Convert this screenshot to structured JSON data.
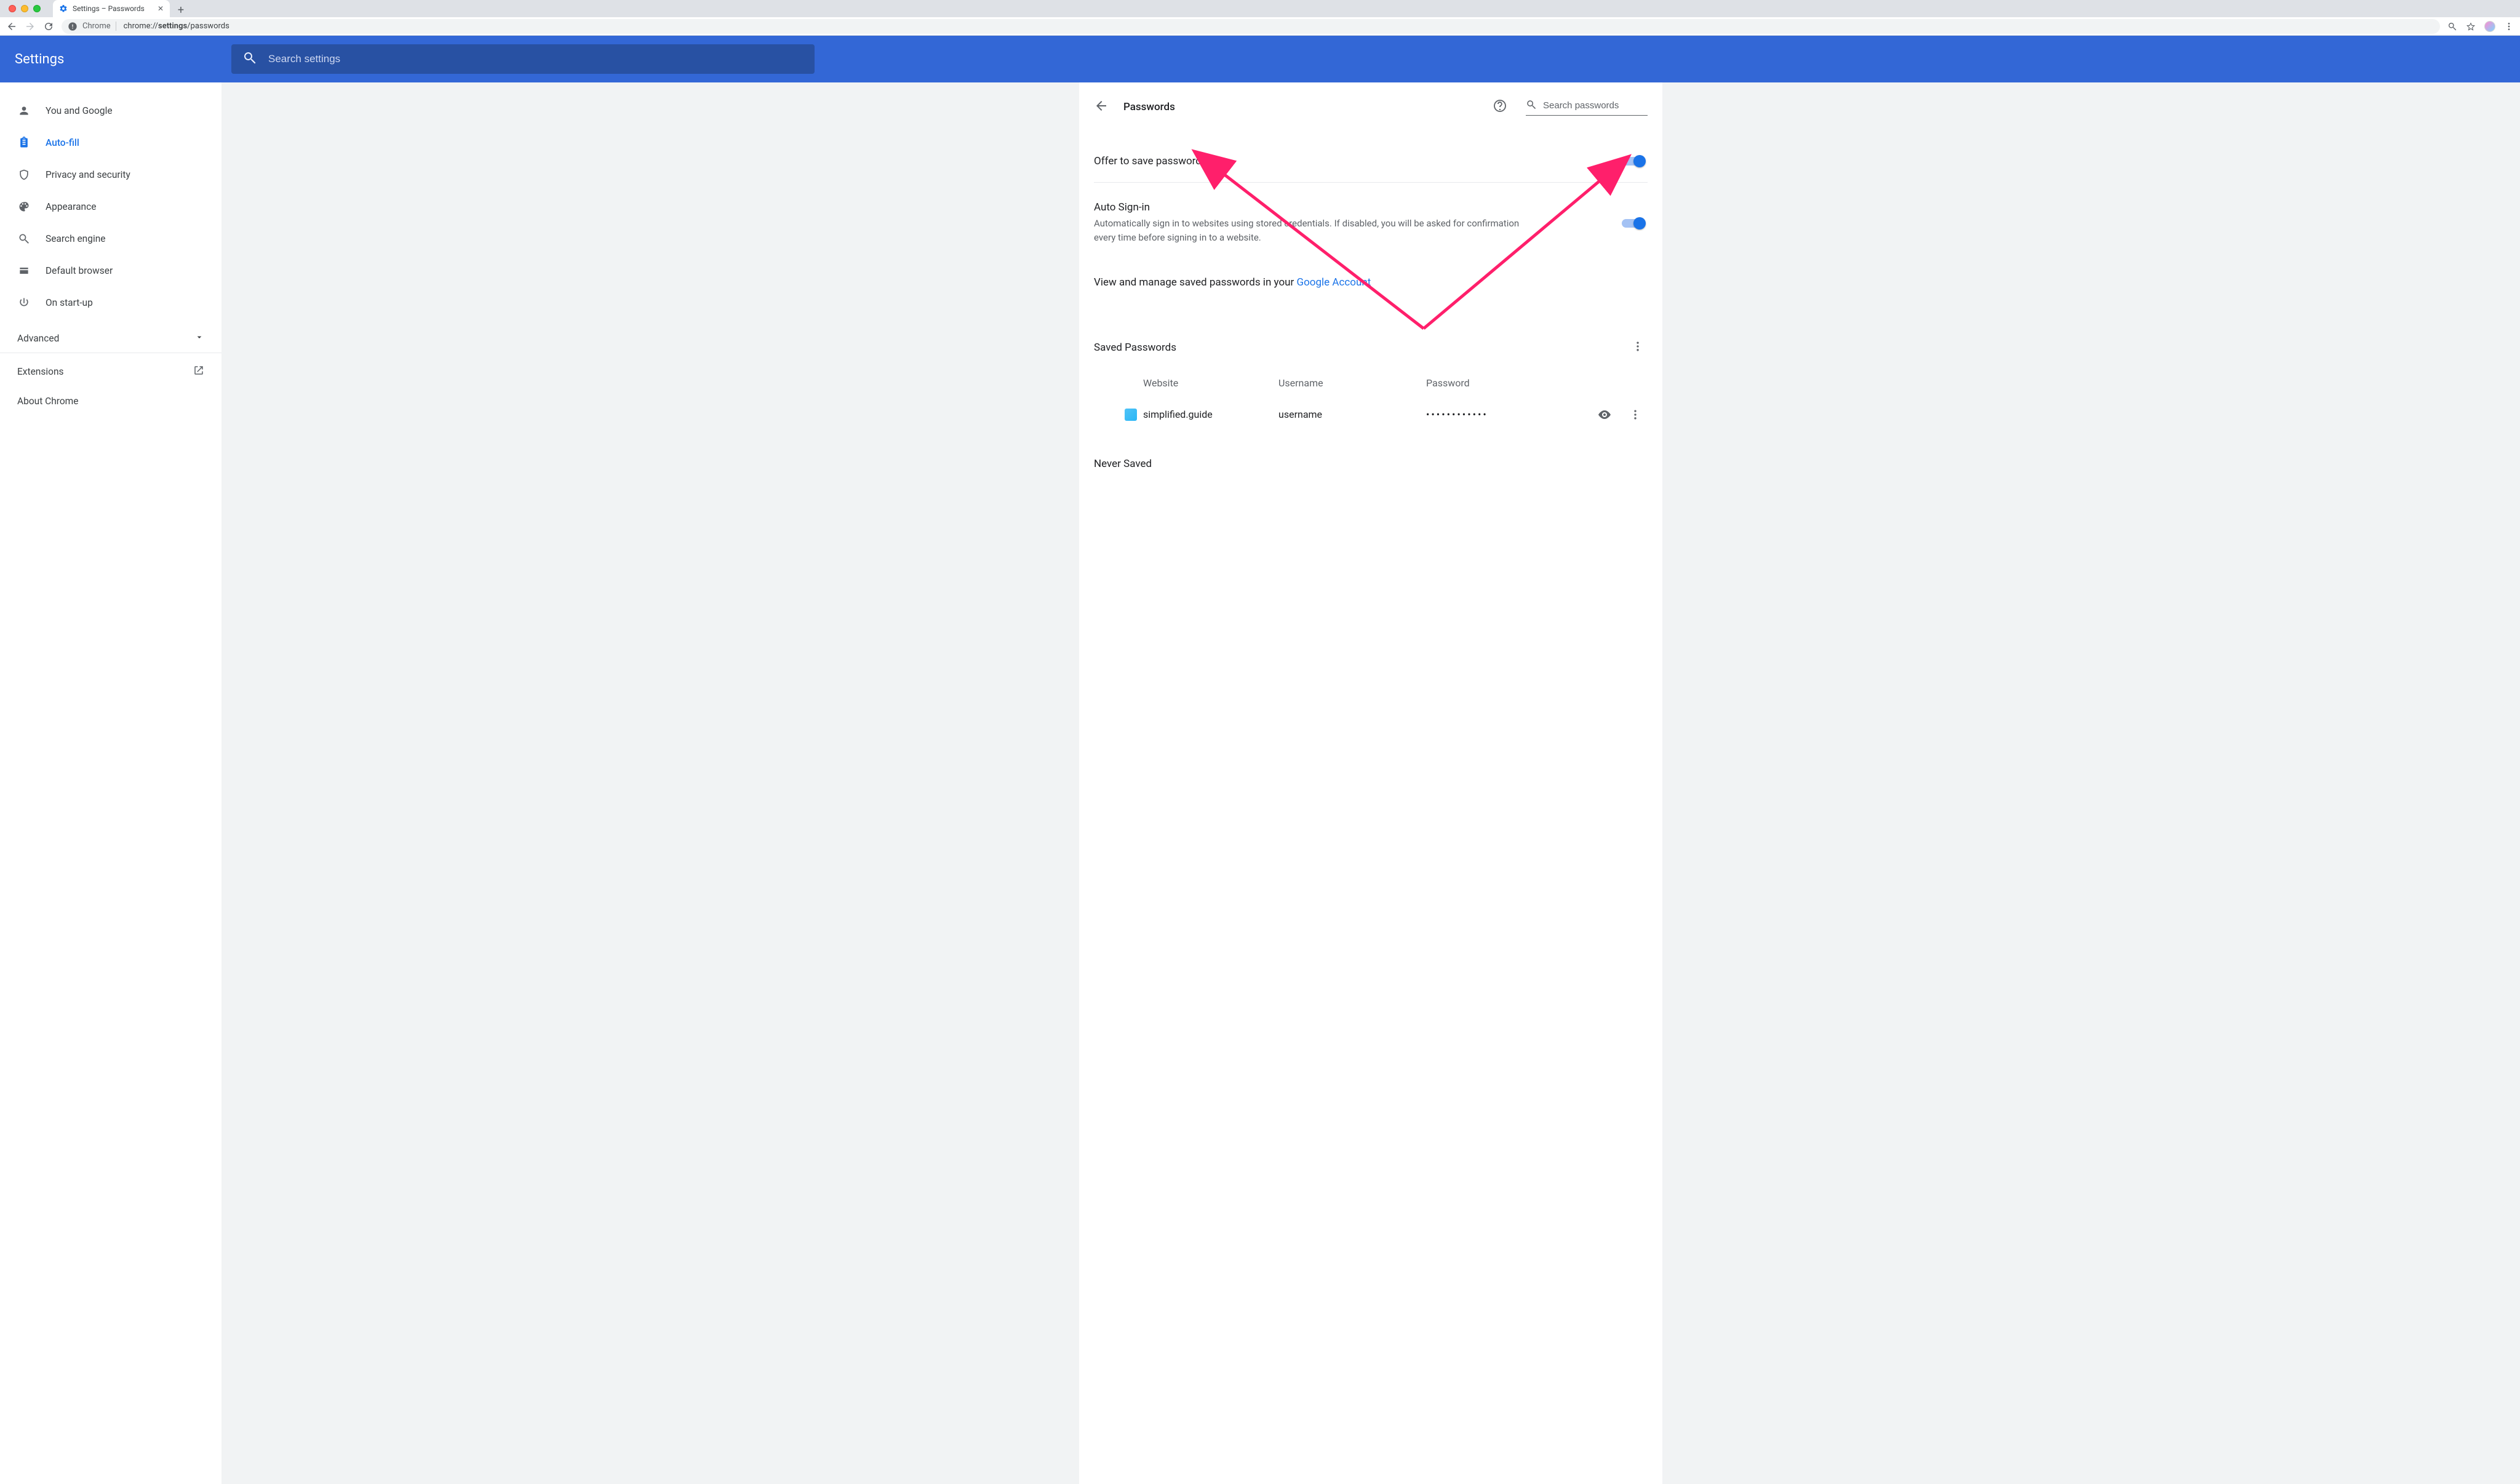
{
  "browser": {
    "tab_title": "Settings – Passwords",
    "url_prefix": "Chrome",
    "url_path_plain1": "chrome://",
    "url_bold": "settings",
    "url_path_plain2": "/passwords"
  },
  "app": {
    "title": "Settings",
    "search_placeholder": "Search settings"
  },
  "sidebar": {
    "items": [
      {
        "label": "You and Google"
      },
      {
        "label": "Auto-fill"
      },
      {
        "label": "Privacy and security"
      },
      {
        "label": "Appearance"
      },
      {
        "label": "Search engine"
      },
      {
        "label": "Default browser"
      },
      {
        "label": "On start-up"
      }
    ],
    "advanced": "Advanced",
    "links": [
      {
        "label": "Extensions"
      },
      {
        "label": "About Chrome"
      }
    ]
  },
  "panel": {
    "title": "Passwords",
    "search_placeholder": "Search passwords",
    "offer_label": "Offer to save passwords",
    "autosignin_label": "Auto Sign-in",
    "autosignin_desc": "Automatically sign in to websites using stored credentials. If disabled, you will be asked for confirmation every time before signing in to a website.",
    "view_manage_prefix": "View and manage saved passwords in your ",
    "view_manage_link": "Google Account",
    "saved_title": "Saved Passwords",
    "columns": {
      "site": "Website",
      "user": "Username",
      "pass": "Password"
    },
    "rows": [
      {
        "site": "simplified.guide",
        "user": "username",
        "pass_mask": "••••••••••••"
      }
    ],
    "never_title": "Never Saved"
  }
}
